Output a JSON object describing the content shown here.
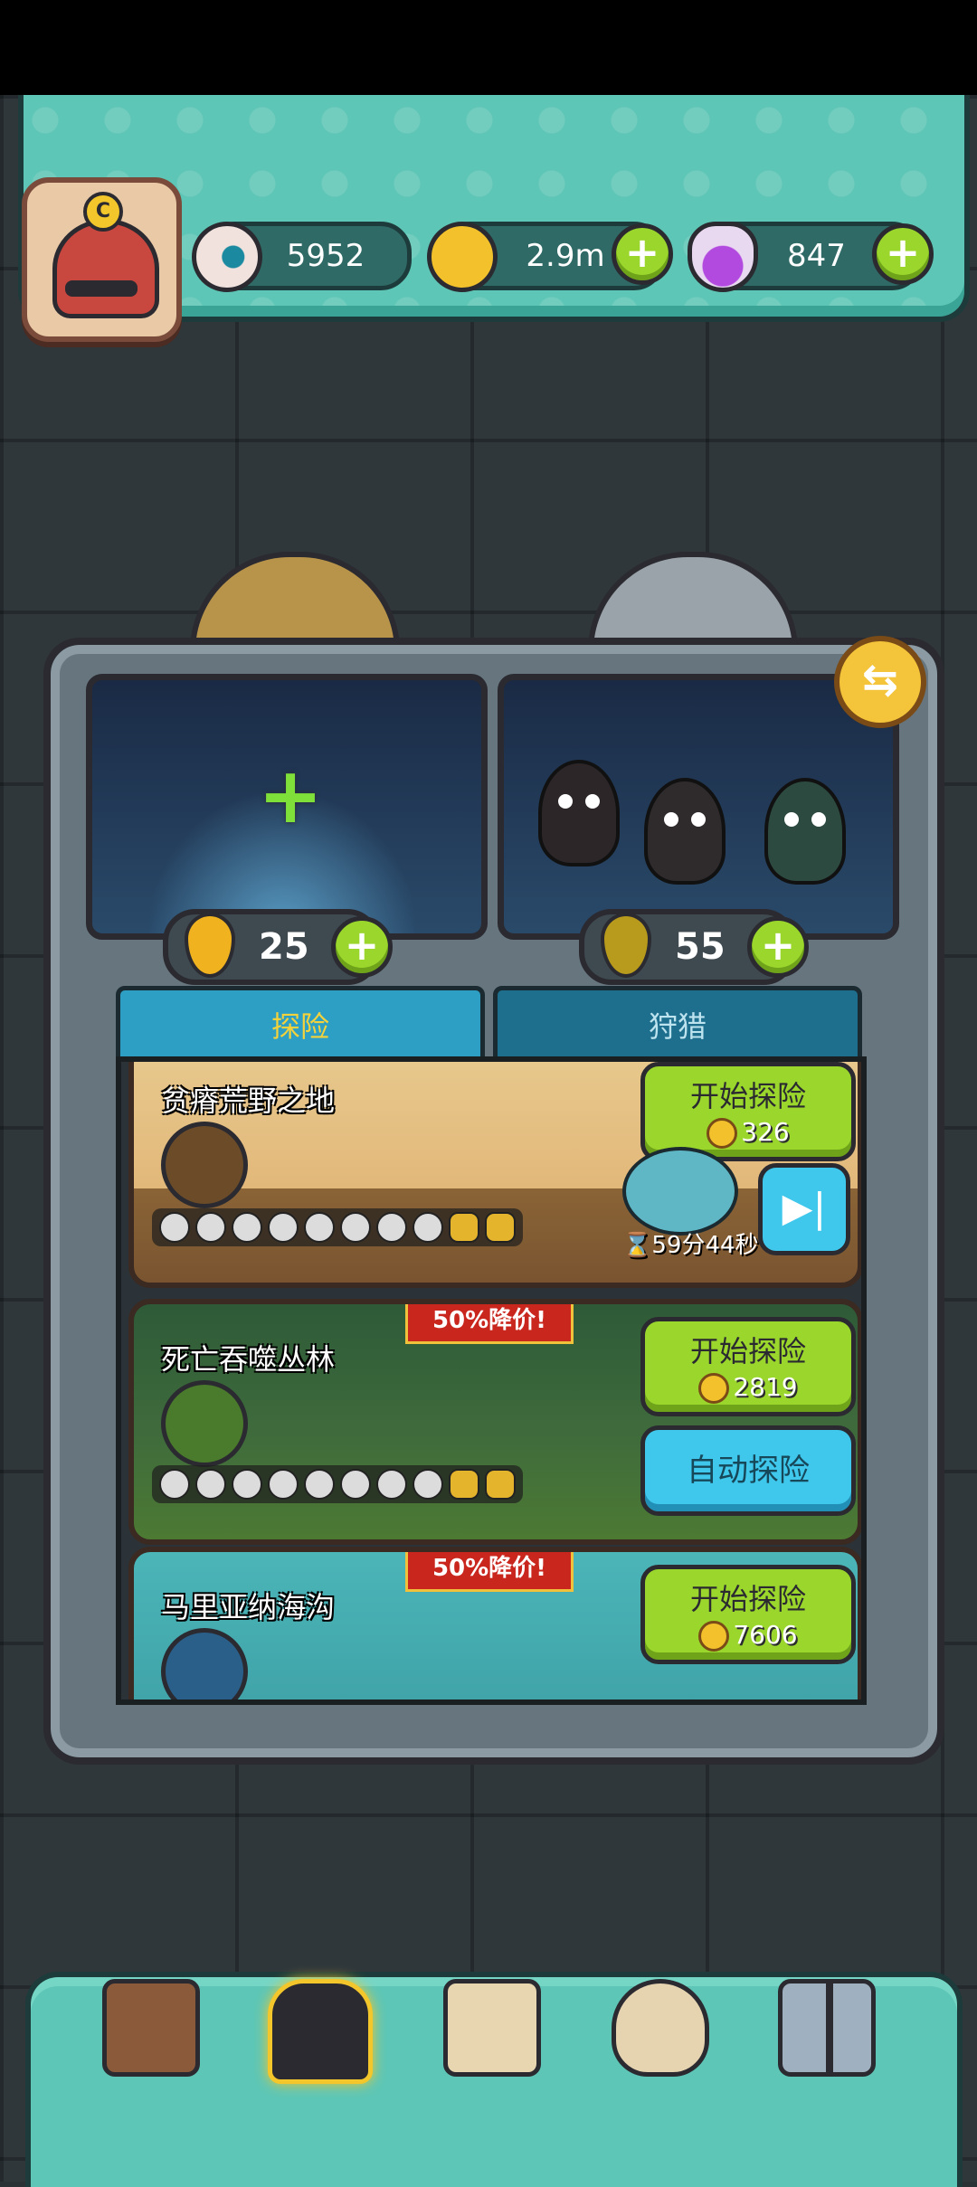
{
  "resources": {
    "eyes": {
      "value": "5952",
      "icon": "eyeball-icon"
    },
    "coins": {
      "value": "2.9m",
      "icon": "coin-icon"
    },
    "potions": {
      "value": "847",
      "icon": "potion-icon"
    }
  },
  "energy": {
    "left": {
      "value": "25",
      "icon": "golden-drop-icon"
    },
    "right": {
      "value": "55",
      "icon": "oil-drop-icon"
    }
  },
  "tabs": [
    {
      "label": "探险",
      "active": true
    },
    {
      "label": "狩猎",
      "active": false
    }
  ],
  "expeditions": [
    {
      "name": "贫瘠荒野之地",
      "start_label": "开始探险",
      "cost": "326",
      "timer": "59分44秒",
      "discount": "",
      "skulls": {
        "gray": 8,
        "gold": 2
      }
    },
    {
      "name": "死亡吞噬丛林",
      "start_label": "开始探险",
      "cost": "2819",
      "auto_label": "自动探险",
      "discount": "50%降价!",
      "skulls": {
        "gray": 8,
        "gold": 2
      }
    },
    {
      "name": "马里亚纳海沟",
      "start_label": "开始探险",
      "cost": "7606",
      "discount": "50%降价!"
    }
  ],
  "nav": [
    {
      "name": "shop",
      "icon": "shop-icon"
    },
    {
      "name": "creatures",
      "icon": "creature-portal-icon",
      "active": true
    },
    {
      "name": "book",
      "icon": "book-icon"
    },
    {
      "name": "bag",
      "icon": "money-bag-icon"
    },
    {
      "name": "more",
      "icon": "grid-icon"
    }
  ],
  "colors": {
    "teal": "#5ec6b6",
    "green_button": "#9ad62b",
    "blue_button": "#3fc7ec",
    "discount_red": "#c9261e"
  }
}
